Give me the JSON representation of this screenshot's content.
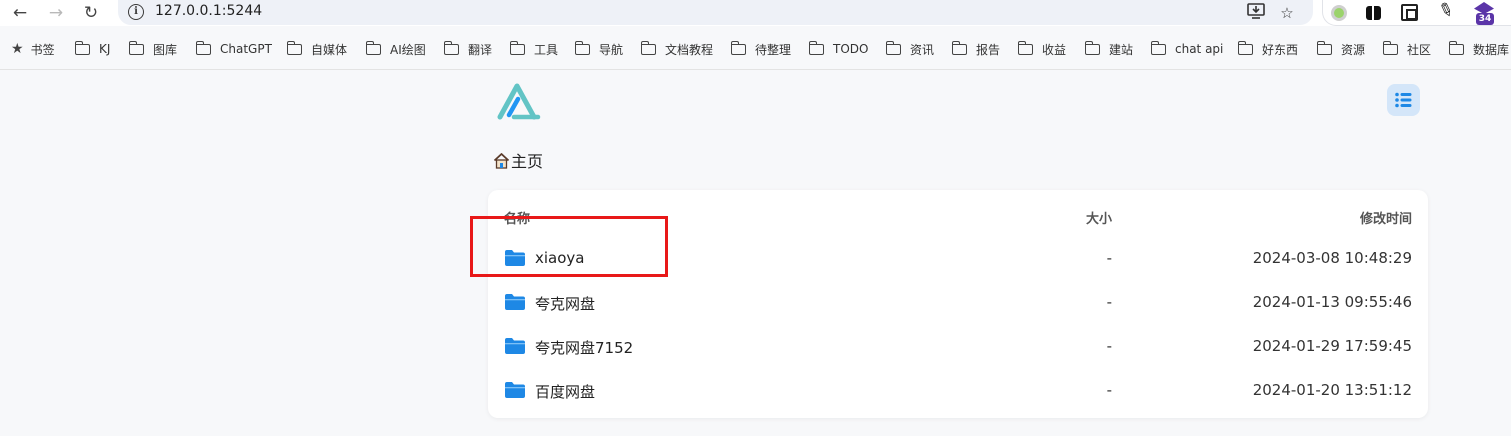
{
  "browser": {
    "url": "127.0.0.1:5244",
    "extension_badge": "34",
    "icons": [
      "back-arrow-icon",
      "forward-arrow-icon",
      "reload-icon",
      "info-icon",
      "install-app-icon",
      "bookmark-star-icon",
      "extension-icons"
    ]
  },
  "bookmarks": [
    "书签",
    "KJ",
    "图库",
    "ChatGPT",
    "自媒体",
    "AI绘图",
    "翻译",
    "工具",
    "导航",
    "文档教程",
    "待整理",
    "TODO",
    "资讯",
    "报告",
    "收益",
    "建站",
    "chat api",
    "好东西",
    "资源",
    "社区",
    "数据库"
  ],
  "breadcrumb": "主页",
  "table": {
    "headers": {
      "name": "名称",
      "size": "大小",
      "modified": "修改时间"
    },
    "rows": [
      {
        "name": "xiaoya",
        "size": "-",
        "modified": "2024-03-08 10:48:29"
      },
      {
        "name": "夸克网盘",
        "size": "-",
        "modified": "2024-01-13 09:55:46"
      },
      {
        "name": "夸克网盘7152",
        "size": "-",
        "modified": "2024-01-29 17:59:45"
      },
      {
        "name": "百度网盘",
        "size": "-",
        "modified": "2024-01-20 13:51:12"
      }
    ]
  },
  "colors": {
    "folder": "#1e88e5",
    "accent_bg": "#d4e6f9",
    "highlight": "#e81818",
    "logo_teal": "#62c4c5",
    "logo_blue": "#2196f3"
  }
}
